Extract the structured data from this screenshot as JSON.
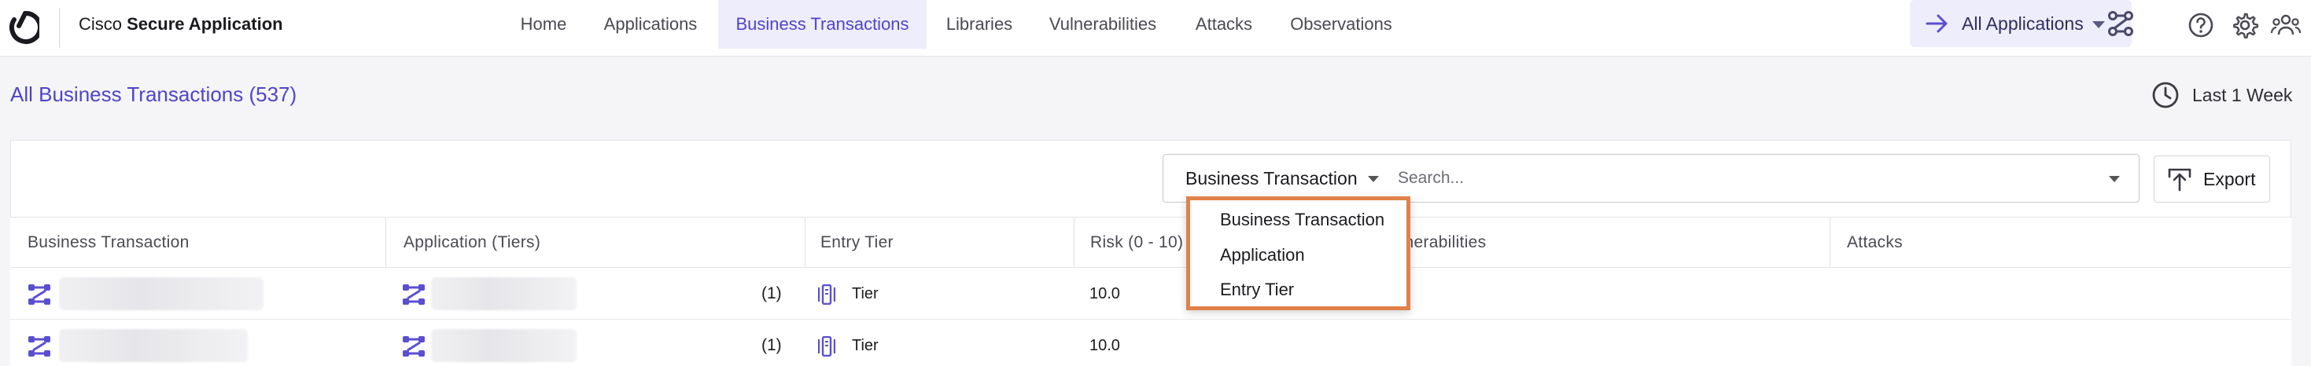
{
  "brand": {
    "prefix": "Cisco ",
    "name": "Secure Application"
  },
  "nav": [
    {
      "label": "Home"
    },
    {
      "label": "Applications"
    },
    {
      "label": "Business Transactions",
      "active": true
    },
    {
      "label": "Libraries"
    },
    {
      "label": "Vulnerabilities"
    },
    {
      "label": "Attacks"
    },
    {
      "label": "Observations"
    }
  ],
  "app_selector": {
    "label": "All Applications"
  },
  "page": {
    "title": "All Business Transactions (537)",
    "time_range": "Last 1 Week"
  },
  "search": {
    "field_label": "Business Transaction",
    "placeholder": "Search..."
  },
  "export_label": "Export",
  "table": {
    "columns": [
      {
        "label": "Business Transaction"
      },
      {
        "label": "Application (Tiers)"
      },
      {
        "label": "Entry Tier"
      },
      {
        "label": "Risk (0 - 10)"
      },
      {
        "label": "Vulnerabilities"
      },
      {
        "label": "Attacks"
      }
    ],
    "rows": [
      {
        "app_count": "(1)",
        "tier": "Tier",
        "risk": "10.0"
      },
      {
        "app_count": "(1)",
        "tier": "Tier",
        "risk": "10.0"
      }
    ]
  },
  "dropdown": {
    "options": [
      {
        "label": "Business Transaction"
      },
      {
        "label": "Application"
      },
      {
        "label": "Entry Tier"
      }
    ]
  },
  "colors": {
    "accent": "#4f44c9",
    "highlight_border": "#e1814a",
    "active_bg": "#eeedfb"
  },
  "icons": [
    "cisco-logo-icon",
    "arrow-right-icon",
    "chevron-down-icon",
    "flow-icon",
    "help-icon",
    "gear-icon",
    "users-icon",
    "clock-icon",
    "export-icon",
    "business-transaction-icon",
    "tier-icon"
  ]
}
